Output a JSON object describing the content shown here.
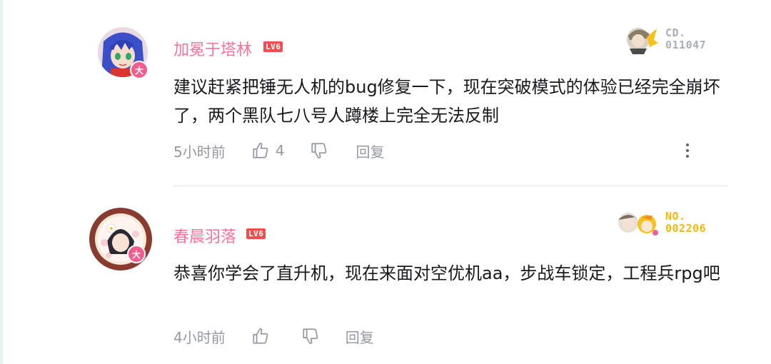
{
  "comments": [
    {
      "username": "加冕于塔林",
      "level": "LV6",
      "avatar_badge": "大",
      "text": "建议赶紧把锤无人机的bug修复一下，现在突破模式的体验已经完全崩坏了，两个黑队七八号人蹲楼上完全无法反制",
      "time": "5小时前",
      "likes": "4",
      "reply_label": "回复",
      "fan_badge": {
        "label": "CD.",
        "number": "011047",
        "color": "#aab0b8"
      }
    },
    {
      "username": "春晨羽落",
      "level": "LV6",
      "avatar_badge": "大",
      "text": "恭喜你学会了直升机，现在来面对空优机aa，步战车锁定，工程兵rpg吧",
      "time": "4小时前",
      "likes": "",
      "reply_label": "回复",
      "fan_badge": {
        "label": "NO.",
        "number": "002206",
        "color": "#f0b90b"
      }
    }
  ],
  "colors": {
    "username": "#fb7299",
    "level_bg": "#f04f4f",
    "badge": "#f25d8e"
  }
}
